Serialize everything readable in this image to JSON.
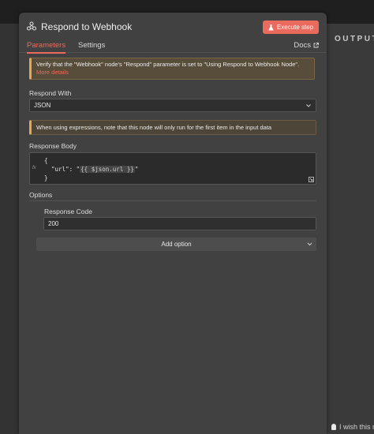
{
  "panel": {
    "title": "Respond to Webhook",
    "execute_label": "Execute step",
    "tabs": [
      {
        "label": "Parameters",
        "active": true
      },
      {
        "label": "Settings",
        "active": false
      }
    ],
    "docs_label": "Docs"
  },
  "warning": {
    "text": "Verify that the \"Webhook\" node's \"Respond\" parameter is set to \"Using Respond to Webhook Node\".",
    "link": "More details"
  },
  "respond_with": {
    "label": "Respond With",
    "value": "JSON"
  },
  "info": {
    "text": "When using expressions, note that this node will only run for the first item in the input data"
  },
  "response_body": {
    "label": "Response Body",
    "fx": "fx",
    "line1": "{",
    "line2_prefix": "  \"url\": \"",
    "line2_expr": "{{ $json.url }}",
    "line2_suffix": "\"",
    "line3": "}"
  },
  "options": {
    "title": "Options",
    "response_code_label": "Response Code",
    "response_code_value": "200",
    "add_option_label": "Add option"
  },
  "right_panel": {
    "output_label": "OUTPUT",
    "feedback_text": "I wish this n"
  },
  "colors": {
    "accent": "#ea6b5d",
    "warning": "#e7a74c",
    "panel_bg": "#414141"
  }
}
